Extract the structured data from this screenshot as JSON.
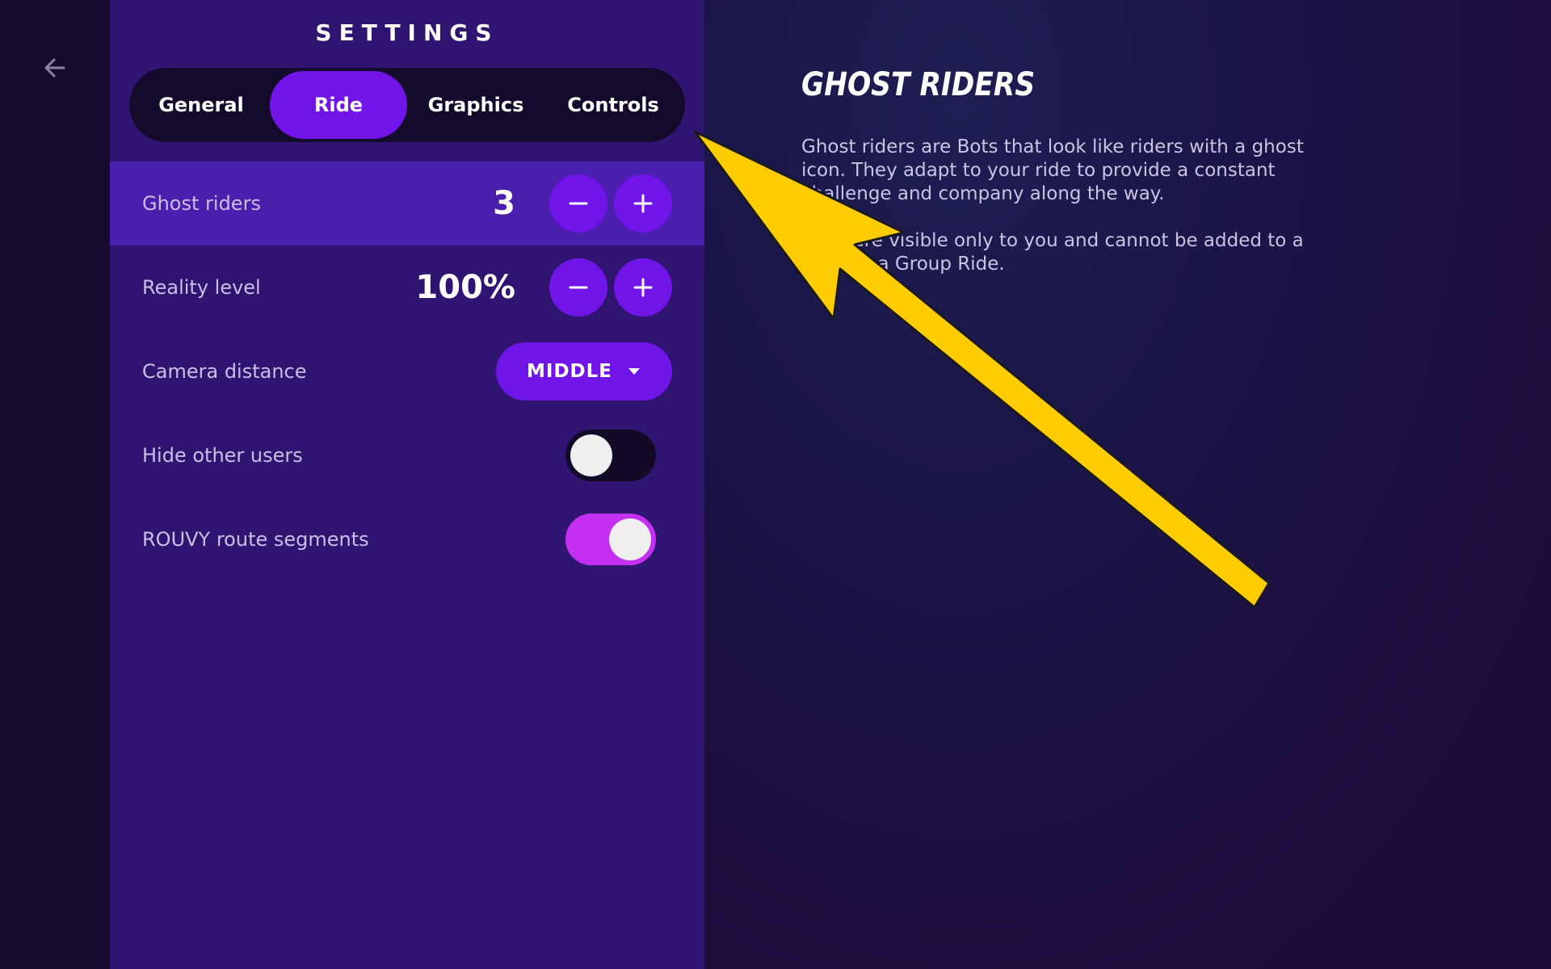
{
  "header": {
    "title": "SETTINGS"
  },
  "tabs": [
    {
      "label": "General",
      "active": false
    },
    {
      "label": "Ride",
      "active": true
    },
    {
      "label": "Graphics",
      "active": false
    },
    {
      "label": "Controls",
      "active": false
    }
  ],
  "settings": {
    "ghost_riders": {
      "label": "Ghost riders",
      "value": "3"
    },
    "reality_level": {
      "label": "Reality level",
      "value": "100%"
    },
    "camera_distance": {
      "label": "Camera distance",
      "value": "MIDDLE"
    },
    "hide_other_users": {
      "label": "Hide other users",
      "enabled": false
    },
    "route_segments": {
      "label": "ROUVY route segments",
      "enabled": true
    }
  },
  "info": {
    "title": "GHOST RIDERS",
    "paragraph_1": "Ghost riders are Bots that look like riders with a ghost icon. They adapt to your ride to provide a constant challenge and company along the way.",
    "paragraph_2": "They are visible only to you and cannot be added to a Race or a Group Ride."
  },
  "colors": {
    "accent": "#7014e8",
    "panel": "#2f1571",
    "highlight_row": "#4a1fad",
    "toggle_on": "#c42ff2",
    "annotation_arrow": "#ffcc00"
  },
  "icons": {
    "back": "arrow-left-icon",
    "minus": "minus-icon",
    "plus": "plus-icon",
    "dropdown": "caret-down-icon"
  }
}
